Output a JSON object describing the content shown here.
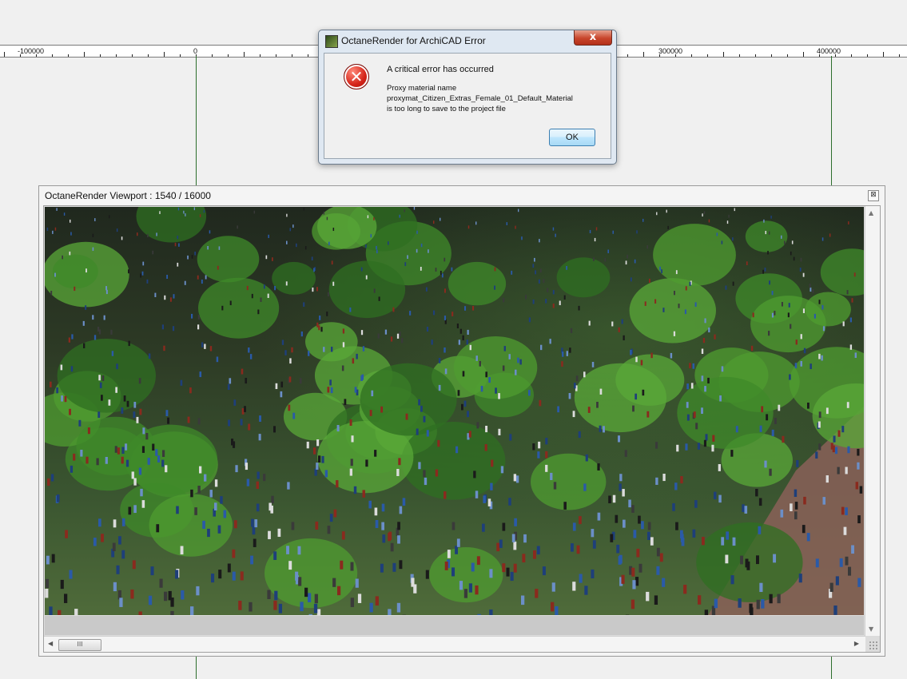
{
  "ruler": {
    "labels": [
      "-100000",
      "0",
      "300000",
      "400000"
    ]
  },
  "error_dialog": {
    "title": "OctaneRender for ArchiCAD Error",
    "close_symbol": "x",
    "message_main": "A critical error has occurred",
    "detail_lines": [
      "Proxy material name",
      "proxymat_Citizen_Extras_Female_01_Default_Material",
      "is too long to save to the project file"
    ],
    "ok_label": "OK",
    "icons": {
      "app": "archicad-app-icon",
      "error": "error-x-icon"
    }
  },
  "viewport": {
    "title": "OctaneRender Viewport : 1540  / 16000",
    "close_symbol": "⊠",
    "scroll_thumb_symbol": "III"
  },
  "colors": {
    "accent_green_line": "#2c6e2c",
    "error_red": "#d5251a",
    "dialog_frame": "#dfe8f2"
  }
}
